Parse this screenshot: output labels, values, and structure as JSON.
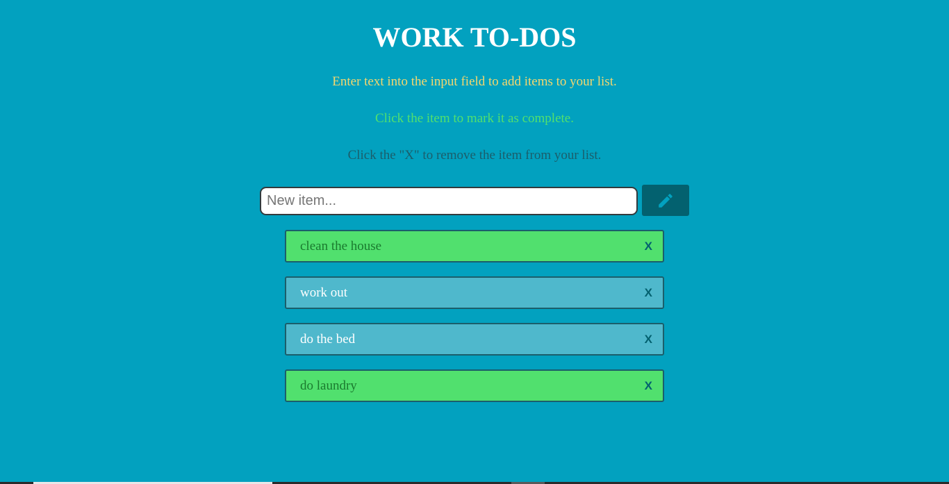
{
  "page": {
    "title": "WORK TO-DOS",
    "instructions": [
      "Enter text into the input field to add items to your list.",
      "Click the item to mark it as complete.",
      "Click the \"X\" to remove the item from your list."
    ]
  },
  "input": {
    "placeholder": "New item...",
    "value": ""
  },
  "add_button": {
    "icon": "pencil-icon"
  },
  "todos": [
    {
      "text": "clean the house",
      "completed": true,
      "remove_label": "X"
    },
    {
      "text": "work out",
      "completed": false,
      "remove_label": "X"
    },
    {
      "text": "do the bed",
      "completed": false,
      "remove_label": "X"
    },
    {
      "text": "do laundry",
      "completed": true,
      "remove_label": "X"
    }
  ],
  "colors": {
    "background": "#02a1bf",
    "title": "#ffffff",
    "instruction_1": "#f5d76e",
    "instruction_2": "#52e06e",
    "instruction_3": "#1b5e6b",
    "button_bg": "#03616f",
    "pencil": "#02a1bf",
    "completed_bg": "#51e06e",
    "completed_text": "#1a7a2e",
    "pending_bg": "#4fb8cc",
    "pending_text": "#ffffff",
    "remove_x": "#03616f"
  }
}
